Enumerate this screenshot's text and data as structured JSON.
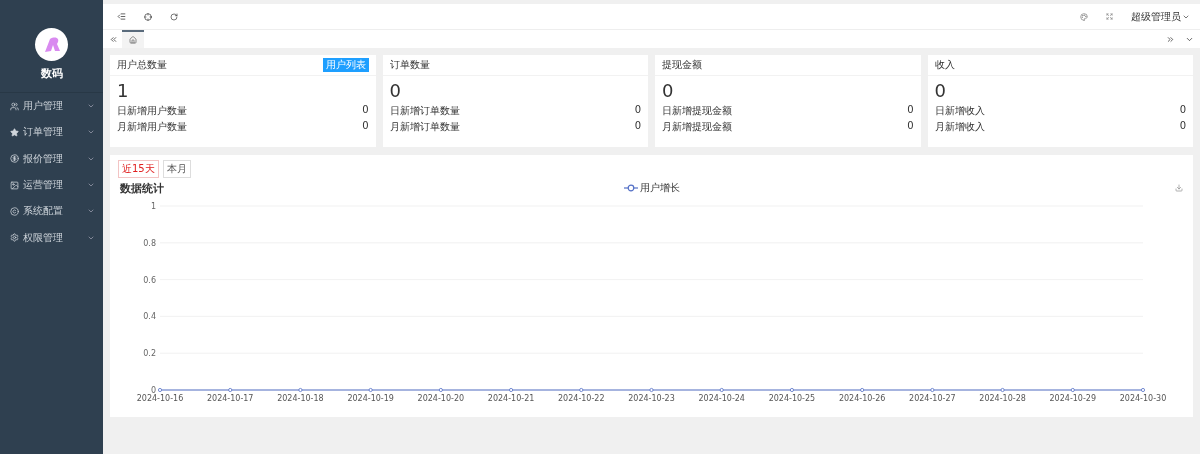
{
  "sidebar": {
    "logo_text": "数码",
    "items": [
      {
        "label": "用户管理",
        "expanded": false
      },
      {
        "label": "订单管理",
        "expanded": false
      },
      {
        "label": "报价管理",
        "expanded": false
      },
      {
        "label": "运营管理",
        "expanded": false
      },
      {
        "label": "系统配置",
        "expanded": false
      },
      {
        "label": "权限管理",
        "expanded": false
      }
    ]
  },
  "header": {
    "user": "超级管理员"
  },
  "tabs": [
    {
      "kind": "home",
      "selected": true
    }
  ],
  "cards": [
    {
      "title": "用户总数量",
      "badge": "用户列表",
      "value": "1",
      "rows": [
        {
          "label": "日新增用户数量",
          "value": "0"
        },
        {
          "label": "月新增用户数量",
          "value": "0"
        }
      ]
    },
    {
      "title": "订单数量",
      "value": "0",
      "rows": [
        {
          "label": "日新增订单数量",
          "value": "0"
        },
        {
          "label": "月新增订单数量",
          "value": "0"
        }
      ]
    },
    {
      "title": "提现金额",
      "value": "0",
      "rows": [
        {
          "label": "日新增提现金额",
          "value": "0"
        },
        {
          "label": "月新增提现金额",
          "value": "0"
        }
      ]
    },
    {
      "title": "收入",
      "value": "0",
      "rows": [
        {
          "label": "日新增收入",
          "value": "0"
        },
        {
          "label": "月新增收入",
          "value": "0"
        }
      ]
    }
  ],
  "stats": {
    "ranges": [
      {
        "label": "近15天",
        "selected": true
      },
      {
        "label": "本月",
        "selected": false
      }
    ],
    "title": "数据统计",
    "chart_data": {
      "type": "line",
      "x": [
        "2024-10-16",
        "2024-10-17",
        "2024-10-18",
        "2024-10-19",
        "2024-10-20",
        "2024-10-21",
        "2024-10-22",
        "2024-10-23",
        "2024-10-24",
        "2024-10-25",
        "2024-10-26",
        "2024-10-27",
        "2024-10-28",
        "2024-10-29",
        "2024-10-30"
      ],
      "series": [
        {
          "name": "用户增长",
          "color": "#5470c6",
          "marker": true,
          "values": [
            0,
            0,
            0,
            0,
            0,
            0,
            0,
            0,
            0,
            0,
            0,
            0,
            0,
            0,
            0
          ]
        }
      ],
      "ylim": [
        0,
        1
      ],
      "yticks": [
        0,
        0.2,
        0.4,
        0.6,
        0.8,
        1
      ],
      "grid": true
    }
  }
}
